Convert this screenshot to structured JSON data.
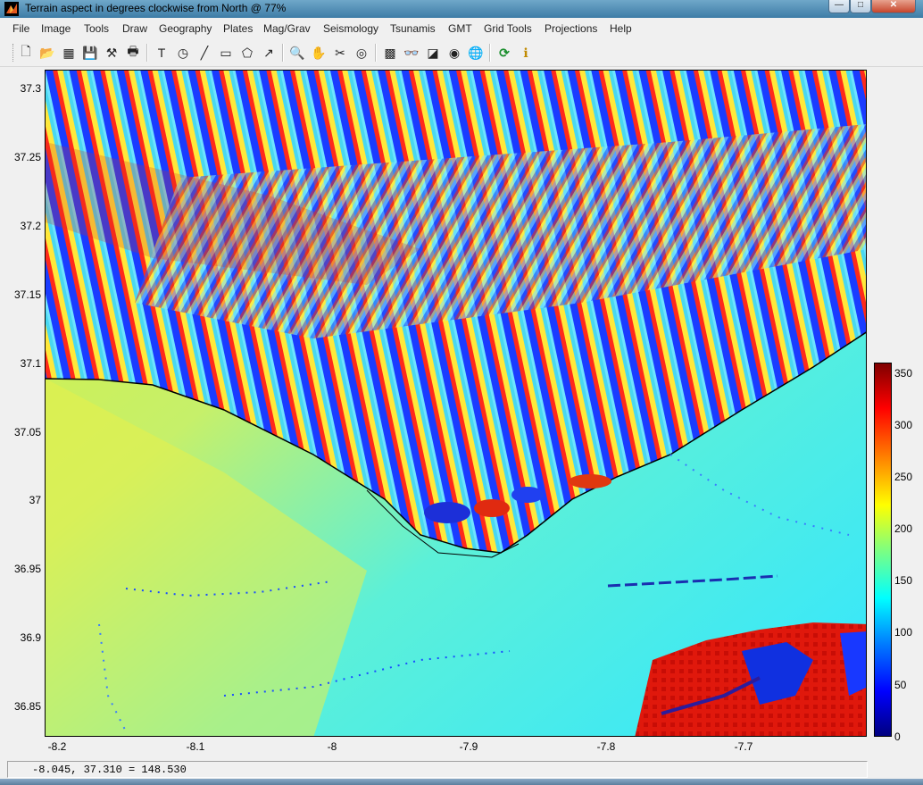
{
  "window": {
    "title": "Terrain aspect in degrees clockwise from North  @  77%",
    "buttons": {
      "minimize": "—",
      "maximize": "□",
      "close": "✕"
    }
  },
  "menu": [
    "File",
    "Image",
    "Tools",
    "Draw",
    "Geography",
    "Plates",
    "Mag/Grav",
    "Seismology",
    "Tsunamis",
    "GMT",
    "Grid Tools",
    "Projections",
    "Help"
  ],
  "toolbar": [
    {
      "name": "new-file-icon",
      "glyph": "🗋"
    },
    {
      "name": "open-folder-icon",
      "glyph": "📂"
    },
    {
      "name": "image-icon",
      "glyph": "▦"
    },
    {
      "name": "save-icon",
      "glyph": "💾"
    },
    {
      "name": "tools-icon",
      "glyph": "⚒"
    },
    {
      "name": "print-icon",
      "glyph": "🖶"
    },
    {
      "name": "text-icon",
      "glyph": "T"
    },
    {
      "name": "circle-icon",
      "glyph": "◷"
    },
    {
      "name": "line-icon",
      "glyph": "╱"
    },
    {
      "name": "rectangle-icon",
      "glyph": "▭"
    },
    {
      "name": "polygon-icon",
      "glyph": "⬠"
    },
    {
      "name": "arrow-icon",
      "glyph": "↗"
    },
    {
      "name": "zoom-icon",
      "glyph": "🔍"
    },
    {
      "name": "pan-hand-icon",
      "glyph": "✋"
    },
    {
      "name": "scissors-icon",
      "glyph": "✂"
    },
    {
      "name": "measure-icon",
      "glyph": "◎"
    },
    {
      "name": "grid-icon",
      "glyph": "▩"
    },
    {
      "name": "binoculars-icon",
      "glyph": "👓"
    },
    {
      "name": "shade-icon",
      "glyph": "◪"
    },
    {
      "name": "sphere-icon",
      "glyph": "◉"
    },
    {
      "name": "globe-icon",
      "glyph": "🌐"
    },
    {
      "name": "refresh-icon",
      "glyph": "⟳"
    },
    {
      "name": "info-icon",
      "glyph": "ℹ"
    }
  ],
  "axes": {
    "y_ticks": [
      "37.3",
      "37.25",
      "37.2",
      "37.15",
      "37.1",
      "37.05",
      "37",
      "36.95",
      "36.9",
      "36.85"
    ],
    "x_ticks": [
      "-8.2",
      "-8.1",
      "-8",
      "-7.9",
      "-7.8",
      "-7.7"
    ]
  },
  "colorbar": {
    "ticks": [
      "350",
      "300",
      "250",
      "200",
      "150",
      "100",
      "50",
      "0"
    ]
  },
  "status": {
    "text": "-8.045, 37.310 = 148.530"
  }
}
